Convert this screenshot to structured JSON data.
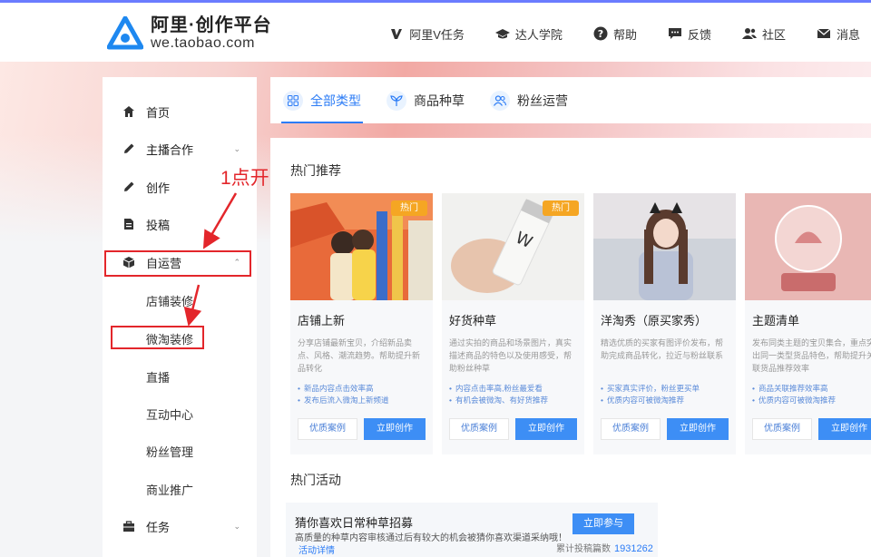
{
  "header": {
    "logo_title": "阿里·创作平台",
    "logo_domain": "we.taobao.com",
    "nav": [
      {
        "label": "阿里V任务",
        "icon": "v-icon"
      },
      {
        "label": "达人学院",
        "icon": "graduation-cap-icon"
      },
      {
        "label": "帮助",
        "icon": "help-icon"
      },
      {
        "label": "反馈",
        "icon": "feedback-icon"
      },
      {
        "label": "社区",
        "icon": "community-icon"
      },
      {
        "label": "消息",
        "icon": "mail-icon"
      }
    ]
  },
  "sidebar": {
    "items": [
      {
        "label": "首页",
        "icon": "home-icon"
      },
      {
        "label": "主播合作",
        "icon": "pencil-icon"
      },
      {
        "label": "创作",
        "icon": "pencil-icon"
      },
      {
        "label": "投稿",
        "icon": "document-icon"
      },
      {
        "label": "自运营",
        "icon": "box-icon"
      },
      {
        "label": "任务",
        "icon": "briefcase-icon"
      }
    ],
    "subitems": [
      "店铺装修",
      "微淘装修",
      "直播",
      "互动中心",
      "粉丝管理",
      "商业推广"
    ]
  },
  "annotation": {
    "text": "1点开自运营",
    "color": "#e3262b"
  },
  "tabs": [
    {
      "label": "全部类型",
      "icon": "grid-icon",
      "active": true
    },
    {
      "label": "商品种草",
      "icon": "sprout-icon",
      "active": false
    },
    {
      "label": "粉丝运营",
      "icon": "users-icon",
      "active": false
    }
  ],
  "main": {
    "hot_title": "热门推荐",
    "activity_title": "热门活动",
    "cards": [
      {
        "title": "店铺上新",
        "badge": "热门",
        "desc": "分享店铺最新宝贝，介绍新品卖点、风格、潮流趋势。帮助提升新品转化",
        "bullets": [
          "新品内容点击效率高",
          "发布后流入微淘上新频道"
        ],
        "case_label": "优质案例",
        "create_label": "立即创作"
      },
      {
        "title": "好货种草",
        "badge": "热门",
        "desc": "通过实拍的商品和场景图片，真实描述商品的特色以及使用感受，帮助粉丝种草",
        "bullets": [
          "内容点击率高,粉丝最爱看",
          "有机会被微淘、有好货推荐"
        ],
        "case_label": "优质案例",
        "create_label": "立即创作"
      },
      {
        "title": "洋淘秀（原买家秀）",
        "badge": "",
        "desc": "精选优质的买家有图评价发布，帮助完成商品转化，拉近与粉丝联系",
        "bullets": [
          "买家真实评价，粉丝更买单",
          "优质内容可被微淘推荐"
        ],
        "case_label": "优质案例",
        "create_label": "立即创作"
      },
      {
        "title": "主题清单",
        "badge": "",
        "desc": "发布同类主题的宝贝集合，重点突出同一类型货品特色，帮助提升关联货品推荐效率",
        "bullets": [
          "商品关联推荐效率高",
          "优质内容可被微淘推荐"
        ],
        "case_label": "优质案例",
        "create_label": "立即创作"
      }
    ],
    "activity": {
      "title": "猜你喜欢日常种草招募",
      "desc": "高质量的种草内容审核通过后有较大的机会被猜你喜欢渠道采纳哦！",
      "link": "活动详情",
      "button": "立即参与",
      "stat_label": "累计投稿篇数",
      "stat_value": "1931262"
    }
  },
  "colors": {
    "accent": "#2c7cf6",
    "button": "#3d8ef5",
    "badge": "#f5a623",
    "annotation": "#e3262b"
  }
}
